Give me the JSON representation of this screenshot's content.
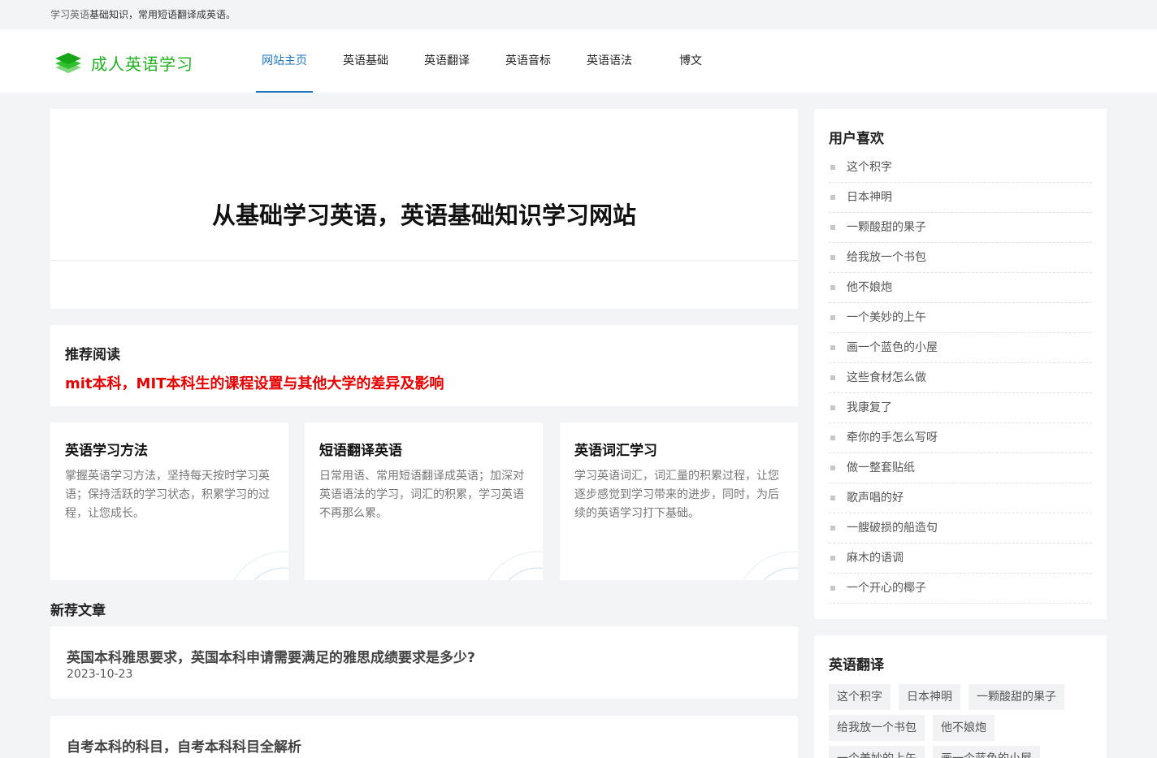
{
  "topbar": {
    "text_prefix": "学习英语",
    "text_rest": "基础知识，常用短语翻译成英语。"
  },
  "header": {
    "logo_icon": "layers-icon",
    "site_name": "成人英语学习",
    "nav": [
      "网站主页",
      "英语基础",
      "英语翻译",
      "英语音标",
      "英语语法",
      "博文"
    ],
    "active_nav": "网站主页",
    "accent_color": "#1e73be",
    "brand_color": "#1db11d"
  },
  "hero": {
    "title": "从基础学习英语，英语基础知识学习网站"
  },
  "recommend": {
    "heading": "推荐阅读",
    "link": "mit本科，MIT本科生的课程设置与其他大学的差异及影响",
    "link_color": "#e60000"
  },
  "cards": [
    {
      "title": "英语学习方法",
      "desc": "掌握英语学习方法，坚持每天按时学习英语；保持活跃的学习状态，积累学习的过程，让您成长。"
    },
    {
      "title": "短语翻译英语",
      "desc": "日常用语、常用短语翻译成英语；加深对英语语法的学习，词汇的积累，学习英语不再那么累。"
    },
    {
      "title": "英语词汇学习",
      "desc": "学习英语词汇，词汇量的积累过程，让您逐步感觉到学习带来的进步，同时，为后续的英语学习打下基础。"
    }
  ],
  "new_articles": {
    "heading": "新荐文章",
    "items": [
      {
        "title": "英国本科雅思要求，英国本科申请需要满足的雅思成绩要求是多少?",
        "date": "2023-10-23"
      },
      {
        "title": "自考本科的科目，自考本科科目全解析",
        "date": ""
      }
    ]
  },
  "sidebar": {
    "favorites": {
      "title": "用户喜欢",
      "items": [
        "这个积字",
        "日本神明",
        "一颗酸甜的果子",
        "给我放一个书包",
        "他不娘炮",
        "一个美妙的上午",
        "画一个蓝色的小屋",
        "这些食材怎么做",
        "我康复了",
        "牵你的手怎么写呀",
        "做一整套贴纸",
        "歌声唱的好",
        "一艘破损的船造句",
        "麻木的语调",
        "一个开心的椰子"
      ]
    },
    "translation": {
      "title": "英语翻译",
      "tags": [
        "这个积字",
        "日本神明",
        "一颗酸甜的果子",
        "给我放一个书包",
        "他不娘炮",
        "一个美妙的上午",
        "画一个蓝色的小屋"
      ]
    }
  }
}
